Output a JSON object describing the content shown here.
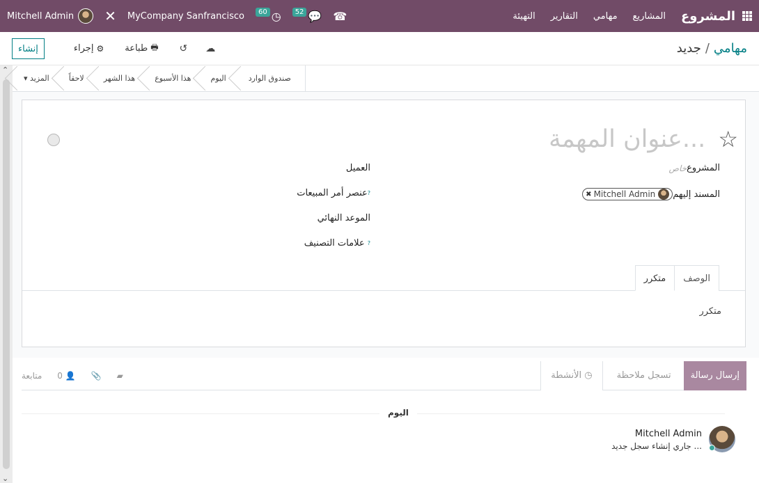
{
  "navbar": {
    "user_name": "Mitchell Admin",
    "company": "MyCompany Sanfrancisco",
    "activity_count": "60",
    "message_count": "52",
    "app_title": "المشروع",
    "menu": [
      "المشاريع",
      "مهامي",
      "التقارير",
      "التهيئة"
    ]
  },
  "control_panel": {
    "create_label": "إنشاء",
    "action_label": "إجراء",
    "print_label": "طباعة",
    "breadcrumb_parent": "مهامي",
    "breadcrumb_current": "جديد"
  },
  "stages": [
    "صندوق الوارد",
    "اليوم",
    "هذا الأسبوع",
    "هذا الشهر",
    "لاحقاً",
    "المزيد"
  ],
  "form": {
    "title_placeholder": "عنوان المهمة...",
    "project_label": "المشروع",
    "project_value": "خاص",
    "assignees_label": "المسند إليهم",
    "assignee_tag": "Mitchell Admin",
    "customer_label": "العميل",
    "sale_line_label": "عنصر أمر المبيعات",
    "deadline_label": "الموعد النهائي",
    "tags_label": "علامات التصنيف",
    "help_mark": "?",
    "tabs": [
      "الوصف",
      "متكرر"
    ],
    "tab_content": "متكرر"
  },
  "chatter": {
    "send_message": "إرسال رسالة",
    "log_note": "تسجل ملاحظة",
    "activities": "الأنشطة",
    "follow": "متابعة",
    "followers_count": "0",
    "today": "اليوم",
    "message_author": "Mitchell Admin",
    "message_text": "جاري إنشاء سجل جديد ..."
  }
}
